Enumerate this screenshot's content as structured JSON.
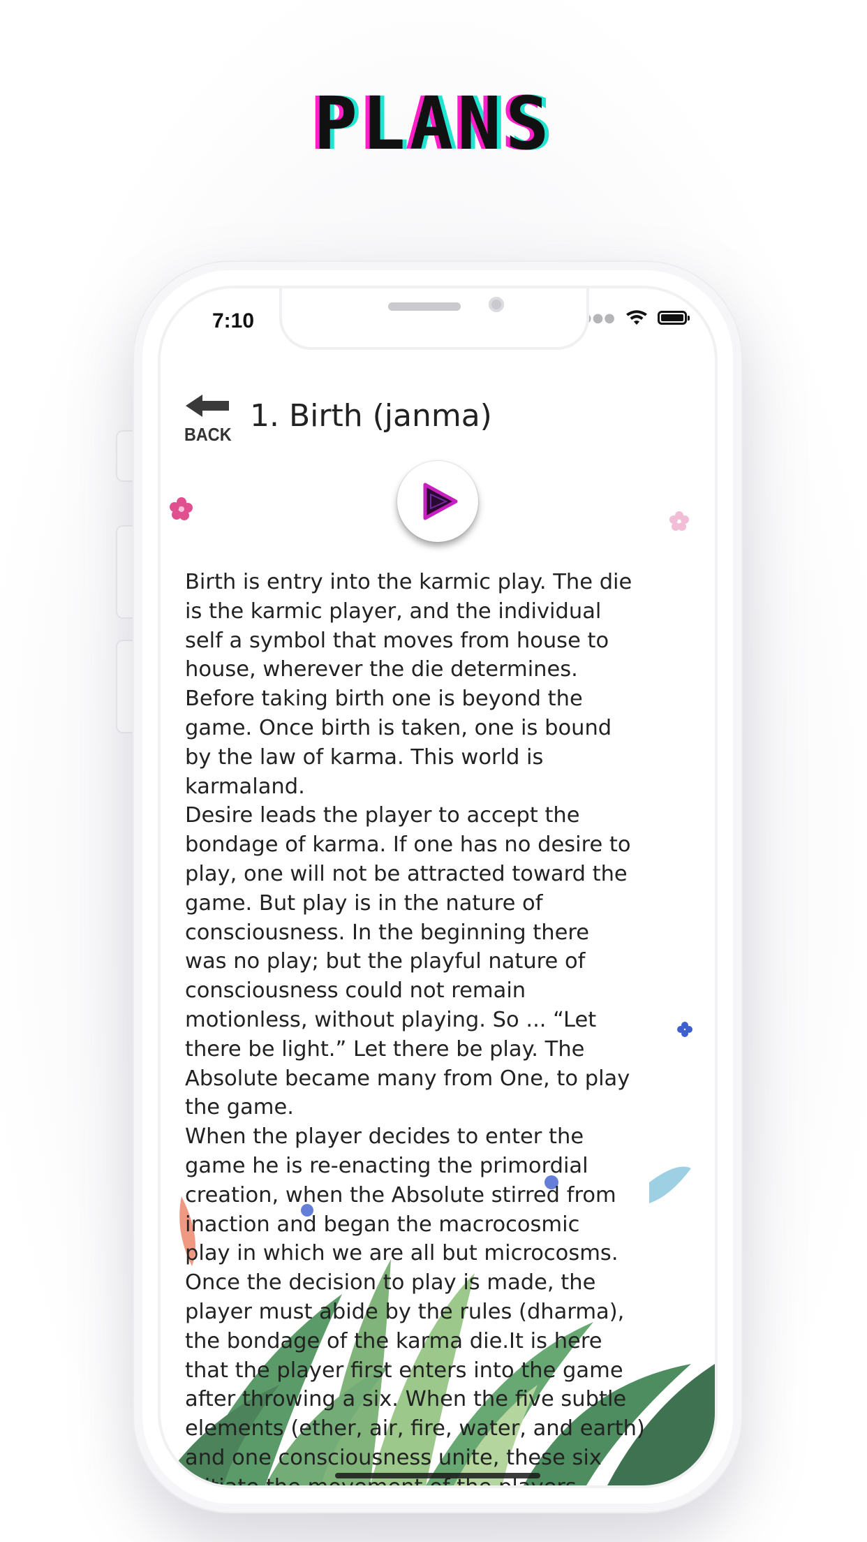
{
  "page": {
    "title": "PLANS"
  },
  "status_bar": {
    "time": "7:10"
  },
  "screen": {
    "back_label": "BACK",
    "title": "1. Birth (janma)",
    "body": "Birth is entry into the karmic play. The die\nis the karmic player, and the individual\nself a symbol that moves from house to\nhouse, wherever the die determines.\nBefore taking birth one is beyond the\ngame. Once birth is taken, one is bound\nby the law of karma. This world is\nkarmaland.\nDesire leads the player to accept the\nbondage of karma. If one has no desire to\nplay, one will not be attracted toward the\ngame. But play is in the nature of\nconsciousness. In the beginning there\nwas no play; but the playful nature of\nconsciousness could not remain\nmotionless, without playing. So ... “Let\nthere be light.” Let there be play. The\nAbsolute became many from One, to play\nthe game.\nWhen the player decides to enter the\ngame he is re-enacting the primordial\ncreation, when the Absolute stirred from\ninaction and began the macrocosmic\nplay in which we are all but microcosms.\nOnce the decision to play is made, the\nplayer must abide by the rules (dharma),\nthe bondage of the karma die.It is here\nthat the player first enters into the game\nafter throwing a six. When the five subtle\nelements (ether, air, fire, water, and earth)\nand one consciousness unite, these six\ninitiate the movement of the players"
  },
  "icons": {
    "back": "back-arrow-icon",
    "play": "play-icon",
    "wifi": "wifi-icon",
    "battery": "battery-icon",
    "signal": "signal-dots-icon"
  },
  "colors": {
    "title_shadow_magenta": "#ff1ec8",
    "title_shadow_cyan": "#22e3d0",
    "play_accent": "#c71fc0",
    "text": "#222222"
  }
}
